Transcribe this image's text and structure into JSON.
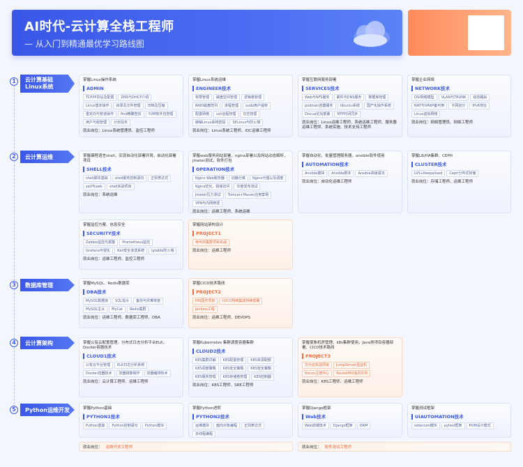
{
  "header": {
    "title": "AI时代-云计算全栈工程师",
    "subtitle": "— 从入门到精通最优学习路线图"
  },
  "sections": [
    {
      "num": "1",
      "label_line1": "云计算基础",
      "label_line2": "Linux系统"
    },
    {
      "num": "2",
      "label_line1": "云计算运维",
      "label_line2": ""
    },
    {
      "num": "3",
      "label_line1": "数据库管理",
      "label_line2": ""
    },
    {
      "num": "4",
      "label_line1": "云计算架构",
      "label_line2": ""
    },
    {
      "num": "5",
      "label_line1": "Python运维开发",
      "label_line2": ""
    }
  ],
  "cards": {
    "s1c1": {
      "title": "掌握Linux操作系统",
      "head": "ADMIN",
      "tags": [
        "TCP/IP协议及配置",
        "DNS与DHCP介绍",
        "Linux基本操作",
        "目录及文件管理",
        "归档及压缩",
        "重定向与管道操作",
        "find精确查找",
        "YUM软件包管理",
        "用户与组管理",
        "计划任务"
      ],
      "job": "就业岗位：Linux系统管理员、监控工程师"
    },
    "s1c2": {
      "title": "掌握Linux系统运维",
      "head": "ENGINEER技术",
      "tags": [
        "权限管理",
        "磁盘空间管理",
        "逻辑卷管理",
        "RAID磁盘阵列",
        "进程管理",
        "sudo用户提权",
        "配置网络",
        "ssh远程管理",
        "日志管理",
        "破解Linux系统密码",
        "SELinux与防火墙"
      ],
      "job": "就业岗位：Linux系统工程师、IDC运维工程师"
    },
    "s1c3": {
      "title": "掌握互联网服务部署",
      "head": "SERVICES技术",
      "tags": [
        "Web与NFS服务",
        "邮件与DNS服务",
        "数据库管理",
        "podman容器服务",
        "Ubuntu系统",
        "国产化操作系统",
        "Discuz论坛部署",
        "NTP时间同步"
      ],
      "job": "就业岗位：Linux运维工程师、系统运维工程师、服务器运维工程师、系统实施、技术支持工程师"
    },
    "s1c4": {
      "title": "掌握企业网络",
      "head": "NETWORK技术",
      "tags": [
        "OSI网络模型",
        "VLAN与TRUNK",
        "动态路由",
        "NAT与VRRP备可用",
        "子网划分",
        "IPv6地址",
        "Linux虚拟网络"
      ],
      "job": "就业岗位：网络管理员、网络工程师"
    },
    "s2c1": {
      "title": "掌握编程语言shell，实现自动化部署环境，自动化部署项目",
      "head": "SHELL技术",
      "tags": [
        "shell脚本基础",
        "shell服务控制语句",
        "正则表达式",
        "sed与awk",
        "shell实战项目"
      ],
      "job": "就业岗位：系统运维"
    },
    "s2c2": {
      "title": "掌握web服务网站部署，nginx部署以及网站动态解析，jmeter测试，软件打包",
      "head": "OPERATION技术",
      "tags": [
        "Nginx Web服务器",
        "动静分离",
        "Nginx代理以及调度",
        "Nginx优化、跨域访问",
        "灰度发布测试",
        "Jmeter压力测试",
        "Tomcat+Maven应用案例",
        "VPN与内网穿透"
      ],
      "job": "就业岗位：运维工程师、系统运维"
    },
    "s2c3": {
      "title": "掌握自动化、批量管理服务器，ansible软件使用",
      "head": "AUTOMATION技术",
      "tags": [
        "Ansible模块",
        "Ansible剧本",
        "Ansible高级语法"
      ],
      "job": "就业岗位：自动化运维工程师"
    },
    "s2c4": {
      "title": "掌握LB/HA集群、CEPH",
      "head": "CLUSTER技术",
      "tags": [
        "LVS+Keepalived",
        "Ceph分布式存储"
      ],
      "job": "就业岗位：存储工程师、运维工程师"
    },
    "s2c5": {
      "title": "掌握监控方案、信息安全",
      "head": "SECURITY技术",
      "tags": [
        "Zabbix监控与报警",
        "Prometheus监控",
        "Grafana可视化",
        "Kali安全渗透系统",
        "iptable防火墙"
      ],
      "job": "就业岗位：运维工程师、监控工程师"
    },
    "s2c6": {
      "title": "掌握网站架构设计",
      "head": "PROJECT1",
      "tags": [
        "电可商集群项目实战"
      ],
      "job": "就业岗位：运维工程师"
    },
    "s3c1": {
      "title": "掌握MySQL、Redis数据库",
      "head": "DBA技术",
      "tags": [
        "MySQL数据库",
        "SQL指令",
        "备份与灾难恢复",
        "MySQL主从",
        "MyCat",
        "Redis集群"
      ],
      "job": "就业岗位：运维工程师、数据库工程师、DBA"
    },
    "s3c2": {
      "title": "掌握CICD技术路线",
      "head": "PROJECT2",
      "tags": [
        "HIS医疗项目",
        "CI/CD持续集成持续部署",
        "Jenkins工程"
      ],
      "job": "就业岗位：运维工程师、DEVOPS"
    },
    "s4c1": {
      "title": "掌握公有云配置管理，分布式日志分析平台ELK，Docker容器技术",
      "head": "CLOUD1技术",
      "tags": [
        "公有云平台管理",
        "ELK日志分析系统",
        "Docker容器技术",
        "容器镜像制作",
        "容器编排技术"
      ],
      "job": "就业岗位：云计算工程师、运维工程师"
    },
    "s4c2": {
      "title": "掌握Kubernetes 集群调度容器集群",
      "head": "CLOUD2技术",
      "tags": [
        "K8S集群详解",
        "K8S配置管理",
        "K8S资源配额",
        "K8S调度策略",
        "K8S安全策略",
        "K8S安全策略",
        "K8S服务管理",
        "K8S存储卷管理",
        "K8S控制器"
      ],
      "job": "就业岗位：K8S工程师、SRE工程师"
    },
    "s4c3": {
      "title": "掌握使象机房管理、k8s集群使用，Java类项目容器部署、CICD技术路线",
      "head": "PROJECT3",
      "tags": [
        "华为云实战项目",
        "JumpServer堡垒机",
        "Nacos注册中心",
        "RocketMQ消息队列"
      ],
      "job": "就业岗位：K8S工程师、运维工程师"
    },
    "s5c1": {
      "title": "掌握Python基础",
      "head": "PYTHON1技术",
      "tags": [
        "Python基础",
        "Python控制语句",
        "Python模块"
      ],
      "job": ""
    },
    "s5c2": {
      "title": "掌握Python进阶",
      "head": "PYTHON2技术",
      "tags": [
        "运维模块",
        "面向对象编程",
        "正则表达式",
        "多线程编程"
      ],
      "job": ""
    },
    "s5c3": {
      "title": "掌握Django框架",
      "head": "Web技术",
      "tags": [
        "Web前端技术",
        "Django框架",
        "ORM"
      ],
      "job": ""
    },
    "s5c4": {
      "title": "掌握测试框架",
      "head": "UIAUTOMATION技术",
      "tags": [
        "selenium模块",
        "pytest框架",
        "POM设计模式"
      ],
      "job": ""
    }
  },
  "python_jobs": [
    {
      "label": "就业岗位：",
      "value": "运维开发工程师"
    },
    {
      "label": "就业岗位：",
      "value": "软件测试工程师"
    }
  ],
  "colors": {
    "primary": "#3a57e8",
    "accent": "#f06a3a"
  },
  "icons": {
    "banner": "cloud-icon"
  }
}
